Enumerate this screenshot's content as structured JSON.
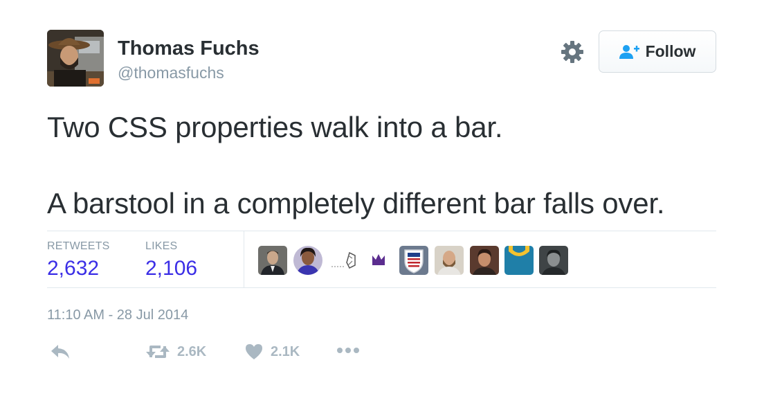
{
  "author": {
    "name": "Thomas Fuchs",
    "handle": "@thomasfuchs",
    "avatar_icon": "profile-photo-man-in-hat"
  },
  "header": {
    "settings_icon": "gear-icon",
    "follow_label": "Follow",
    "follow_icon": "add-user-icon"
  },
  "tweet": {
    "line1": "Two CSS properties walk into a bar.",
    "line2": "A barstool in a completely different bar falls over."
  },
  "stats": {
    "retweets_label": "RETWEETS",
    "retweets_value": "2,632",
    "likes_label": "LIKES",
    "likes_value": "2,106",
    "value_color": "#3b2ee6"
  },
  "likers": [
    {
      "icon": "man-in-suit-avatar"
    },
    {
      "icon": "woman-portrait-avatar"
    },
    {
      "icon": "sketch-logo-avatar"
    },
    {
      "icon": "purple-crown-avatar"
    },
    {
      "icon": "usa-shield-avatar"
    },
    {
      "icon": "bearded-man-avatar"
    },
    {
      "icon": "man-dark-hair-avatar"
    },
    {
      "icon": "yellow-blue-logo-avatar"
    },
    {
      "icon": "man-grey-avatar"
    }
  ],
  "timestamp": "11:10 AM - 28 Jul 2014",
  "actions": {
    "reply_icon": "reply-icon",
    "retweet_icon": "retweet-icon",
    "retweet_count": "2.6K",
    "like_icon": "heart-icon",
    "like_count": "2.1K",
    "more_icon": "more-dots-icon"
  },
  "colors": {
    "text": "#292f33",
    "muted": "#8899a6",
    "action_grey": "#aab8c2",
    "divider": "#e1e8ed"
  }
}
